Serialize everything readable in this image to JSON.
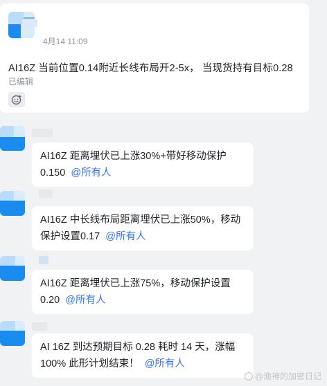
{
  "top_message": {
    "timestamp": "4月14 11:09",
    "text": "AI16Z 当前位置0.14附近长线布局开2-5x， 当现货持有目标0.28",
    "edited_label": "已编辑",
    "reaction_icon": "add-reaction-icon"
  },
  "messages": [
    {
      "line1": "AI16Z 距离埋伏已上涨30%+带好移动保护",
      "line2": "0.150",
      "mention": "@所有人"
    },
    {
      "line1": "AI16Z 中长线布局距离埋伏已上涨50%，移动",
      "line2": "保护设置0.17",
      "mention": "@所有人"
    },
    {
      "line1": "AI16Z 距离埋伏已上涨75%，移动保护设置",
      "line2": "0.20",
      "mention": "@所有人"
    },
    {
      "line1": "AI 16Z 到达预期目标 0.28 耗时 14 天，涨幅",
      "line2": "100% 此形计划结束！",
      "mention": "@所有人"
    }
  ],
  "watermark": "@渔神的加密日记",
  "colors": {
    "mention": "#3370ff",
    "avatar_blue": "#1a8cf0",
    "background": "#f1f2f4"
  }
}
